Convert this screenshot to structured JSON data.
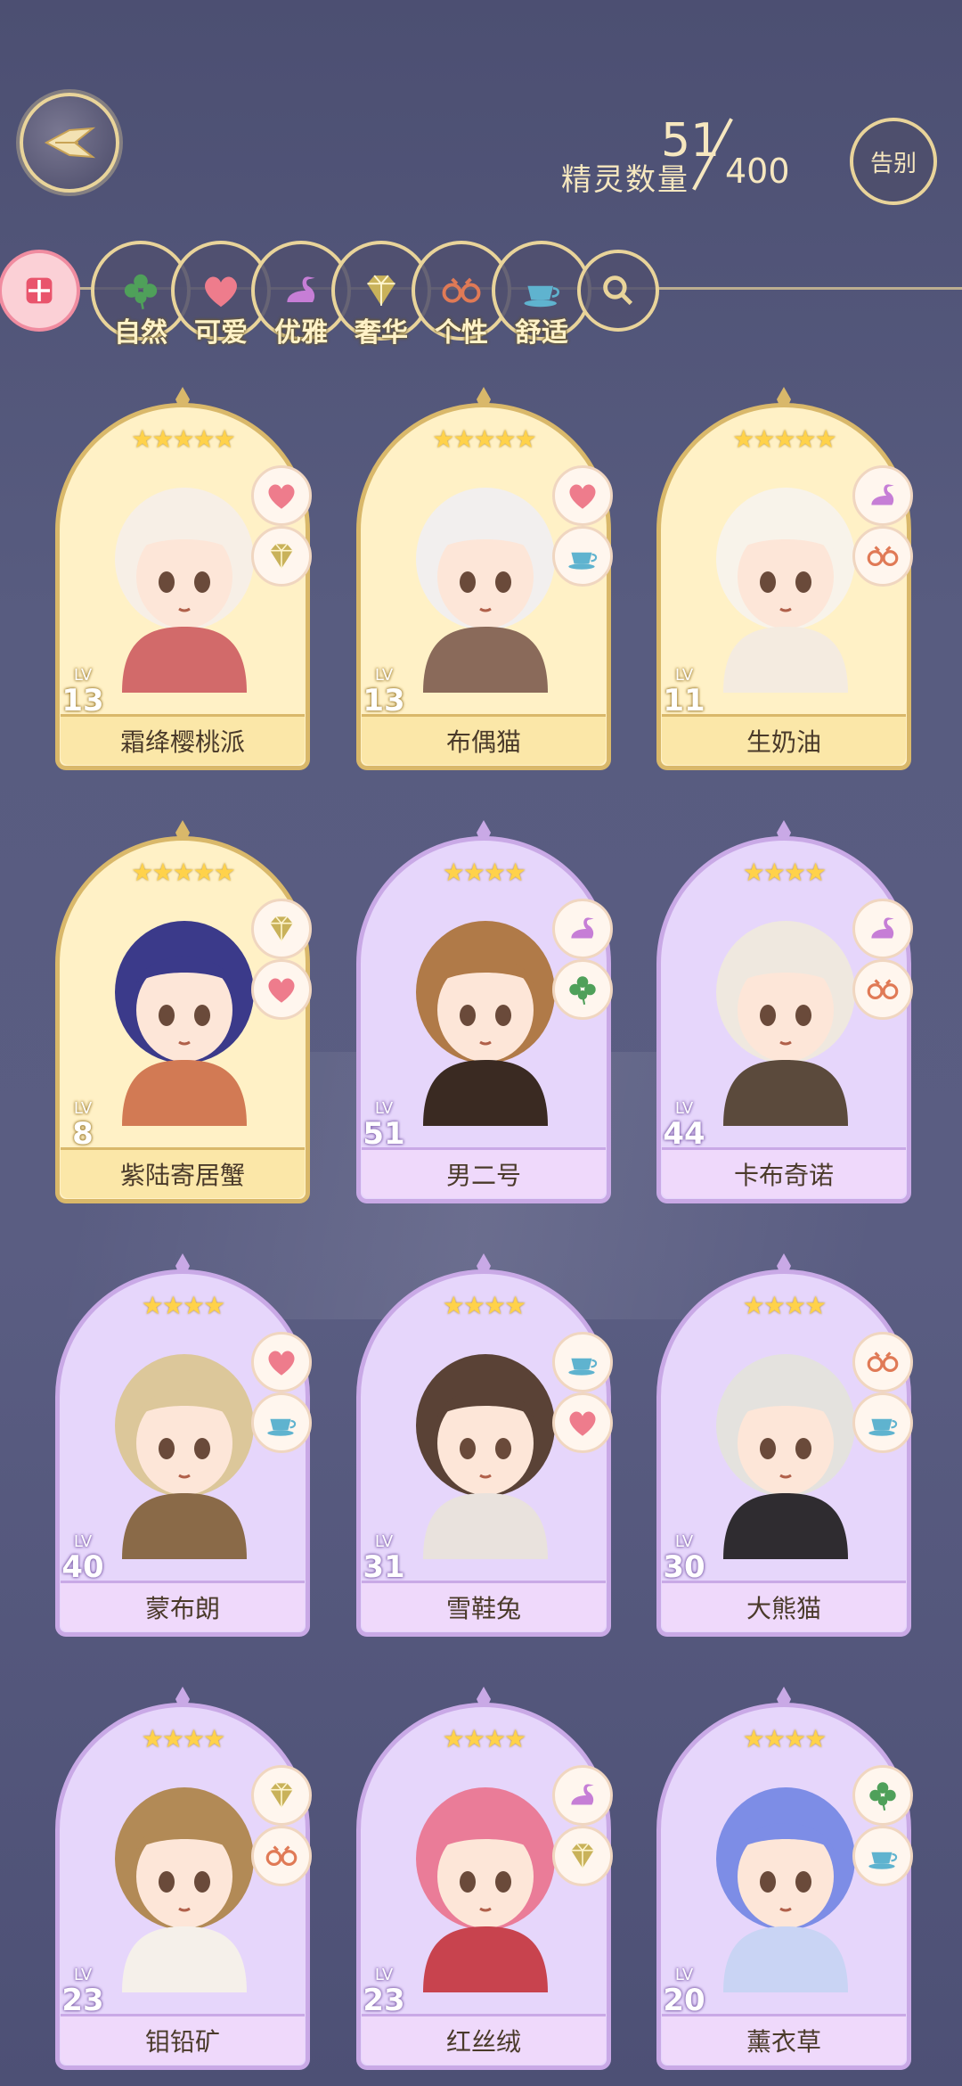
{
  "header": {
    "count_label": "精灵数量",
    "count_value": "51",
    "count_max": "400",
    "farewell_label": "告别"
  },
  "filters": [
    {
      "label": "",
      "icon": "grid-icon"
    },
    {
      "label": "自然",
      "icon": "clover-icon"
    },
    {
      "label": "可爱",
      "icon": "heart-icon"
    },
    {
      "label": "优雅",
      "icon": "swan-icon"
    },
    {
      "label": "奢华",
      "icon": "diamond-icon"
    },
    {
      "label": "个性",
      "icon": "glasses-icon"
    },
    {
      "label": "舒适",
      "icon": "teacup-icon"
    },
    {
      "label": "",
      "icon": "search-icon"
    }
  ],
  "cards": [
    {
      "name": "霜绛樱桃派",
      "level": "13",
      "stars": 5,
      "tier": "gold",
      "badges": [
        "heart-icon",
        "diamond-icon"
      ],
      "hair": "#f7efe6",
      "outfit": "#d26a6a"
    },
    {
      "name": "布偶猫",
      "level": "13",
      "stars": 5,
      "tier": "gold",
      "badges": [
        "heart-icon",
        "teacup-icon"
      ],
      "hair": "#f2efee",
      "outfit": "#8a6a5a"
    },
    {
      "name": "生奶油",
      "level": "11",
      "stars": 5,
      "tier": "gold",
      "badges": [
        "swan-icon",
        "glasses-icon"
      ],
      "hair": "#f8f3ea",
      "outfit": "#f4ebe0"
    },
    {
      "name": "紫陆寄居蟹",
      "level": "8",
      "stars": 5,
      "tier": "gold",
      "badges": [
        "diamond-icon",
        "heart-icon"
      ],
      "hair": "#3b3a8a",
      "outfit": "#d27a54"
    },
    {
      "name": "男二号",
      "level": "51",
      "stars": 4,
      "tier": "purple",
      "badges": [
        "swan-icon",
        "clover-icon"
      ],
      "hair": "#b07a48",
      "outfit": "#3a2a22"
    },
    {
      "name": "卡布奇诺",
      "level": "44",
      "stars": 4,
      "tier": "purple",
      "badges": [
        "swan-icon",
        "glasses-icon"
      ],
      "hair": "#efe8df",
      "outfit": "#5b4a3c"
    },
    {
      "name": "蒙布朗",
      "level": "40",
      "stars": 4,
      "tier": "purple",
      "badges": [
        "heart-icon",
        "teacup-icon"
      ],
      "hair": "#dcc79a",
      "outfit": "#8a6a48"
    },
    {
      "name": "雪鞋兔",
      "level": "31",
      "stars": 4,
      "tier": "purple",
      "badges": [
        "teacup-icon",
        "heart-icon"
      ],
      "hair": "#5a4236",
      "outfit": "#e9e2dd"
    },
    {
      "name": "大熊猫",
      "level": "30",
      "stars": 4,
      "tier": "purple",
      "badges": [
        "glasses-icon",
        "teacup-icon"
      ],
      "hair": "#e4e2de",
      "outfit": "#2f2c30"
    },
    {
      "name": "钼铅矿",
      "level": "23",
      "stars": 4,
      "tier": "purple",
      "badges": [
        "diamond-icon",
        "glasses-icon"
      ],
      "hair": "#b28a56",
      "outfit": "#f5f0ea"
    },
    {
      "name": "红丝绒",
      "level": "23",
      "stars": 4,
      "tier": "purple",
      "badges": [
        "swan-icon",
        "diamond-icon"
      ],
      "hair": "#ea7c98",
      "outfit": "#c8434e"
    },
    {
      "name": "薰衣草",
      "level": "20",
      "stars": 4,
      "tier": "purple",
      "badges": [
        "clover-icon",
        "teacup-icon"
      ],
      "hair": "#7d8de6",
      "outfit": "#c9d4f4"
    }
  ],
  "colors": {
    "gold": "#d9b86a",
    "purple": "#c9a9e6",
    "heart": "#ee7c8c",
    "diamond": "#c9b25a",
    "swan": "#c67ed6",
    "clover": "#4fa05a",
    "teacup": "#5fb3cf",
    "glasses": "#e07a56"
  }
}
